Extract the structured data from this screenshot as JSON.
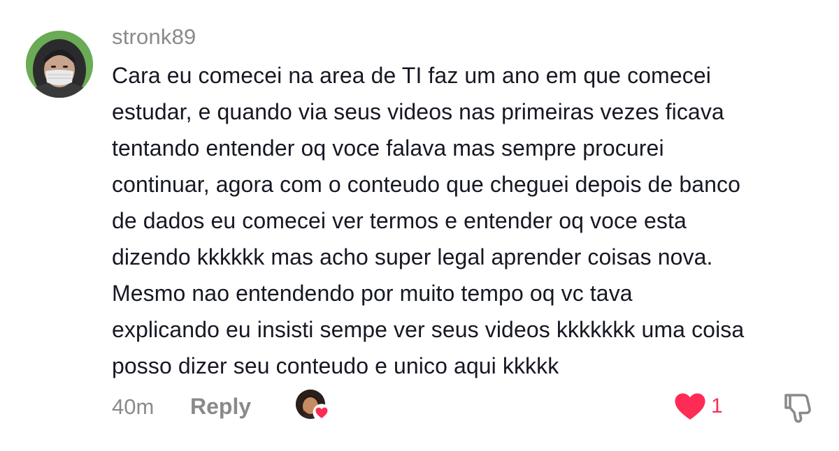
{
  "comment": {
    "avatar_icon": "user-avatar-masked",
    "username": "stronk89",
    "lines": [
      "Cara eu comecei na area de TI faz um ano em que comecei",
      "estudar, e quando via seus videos nas primeiras vezes ficava",
      "tentando entender oq voce falava mas sempre procurei",
      "continuar, agora com o conteudo que cheguei depois de banco",
      "de dados eu comecei ver termos e entender oq voce esta",
      "dizendo kkkkkk mas acho super legal aprender coisas nova.",
      "Mesmo nao entendendo por muito tempo oq vc tava",
      "explicando eu insisti sempe ver seus videos kkkkkkk uma coisa",
      "posso dizer seu conteudo e unico aqui kkkkk"
    ],
    "timestamp": "40m",
    "reply_label": "Reply",
    "creator_liked_icon": "creator-avatar-heart",
    "like_icon": "heart-icon",
    "like_count": "1",
    "dislike_icon": "thumbs-down-icon"
  },
  "colors": {
    "username": "#8a8a8a",
    "text": "#161823",
    "meta": "#8a8a8a",
    "like": "#fe2c55"
  }
}
